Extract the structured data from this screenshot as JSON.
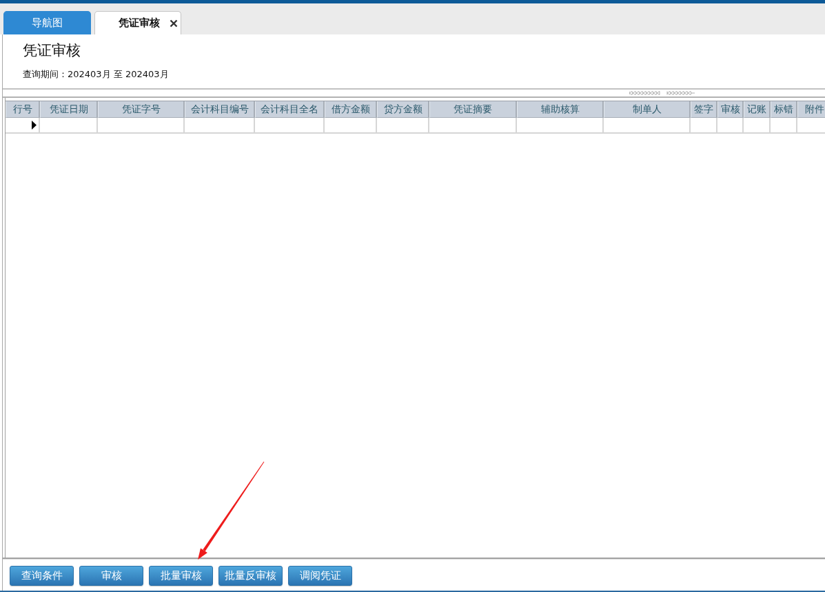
{
  "tabs": [
    {
      "label": "导航图",
      "selected": false,
      "closable": false
    },
    {
      "label": "凭证审核",
      "selected": true,
      "closable": true
    }
  ],
  "page": {
    "title": "凭证审核",
    "period": "查询期间：202403月 至 202403月"
  },
  "table": {
    "columns": [
      "行号",
      "凭证日期",
      "凭证字号",
      "会计科目编号",
      "会计科目全名",
      "借方金额",
      "贷方金额",
      "凭证摘要",
      "辅助核算",
      "制单人",
      "签字",
      "审核",
      "记账",
      "标错",
      "附件"
    ],
    "rows": [
      {
        "current": true
      }
    ]
  },
  "buttons": [
    "查询条件",
    "审核",
    "批量审核",
    "批量反审核",
    "调阅凭证"
  ]
}
